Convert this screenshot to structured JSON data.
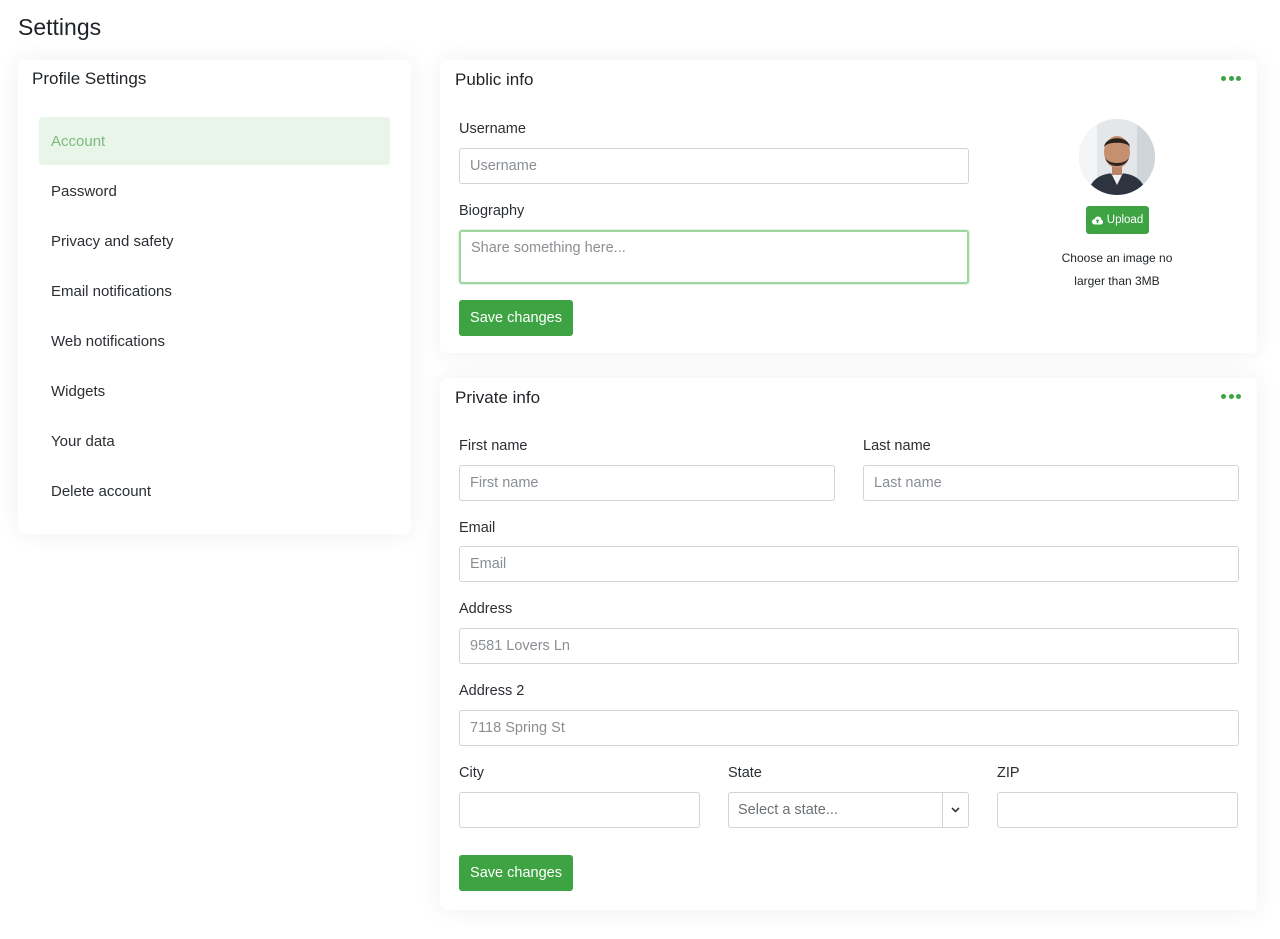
{
  "page": {
    "title": "Settings"
  },
  "sidebar": {
    "title": "Profile Settings",
    "items": [
      {
        "label": "Account",
        "active": true
      },
      {
        "label": "Password"
      },
      {
        "label": "Privacy and safety"
      },
      {
        "label": "Email notifications"
      },
      {
        "label": "Web notifications"
      },
      {
        "label": "Widgets"
      },
      {
        "label": "Your data"
      },
      {
        "label": "Delete account"
      }
    ]
  },
  "public_info": {
    "title": "Public info",
    "username_label": "Username",
    "username_placeholder": "Username",
    "biography_label": "Biography",
    "biography_placeholder": "Share something here...",
    "save_label": "Save changes",
    "upload_label": "Upload",
    "upload_note_line1": "Choose an image no",
    "upload_note_line2": "larger than 3MB"
  },
  "private_info": {
    "title": "Private info",
    "first_name_label": "First name",
    "first_name_placeholder": "First name",
    "last_name_label": "Last name",
    "last_name_placeholder": "Last name",
    "email_label": "Email",
    "email_placeholder": "Email",
    "address_label": "Address",
    "address_placeholder": "9581 Lovers Ln",
    "address2_label": "Address 2",
    "address2_placeholder": "7118 Spring St",
    "city_label": "City",
    "state_label": "State",
    "state_placeholder": "Select a state...",
    "zip_label": "ZIP",
    "save_label": "Save changes"
  },
  "colors": {
    "accent": "#3ea342",
    "active_bg": "#e9f5e9",
    "active_text": "#7cba7e"
  }
}
